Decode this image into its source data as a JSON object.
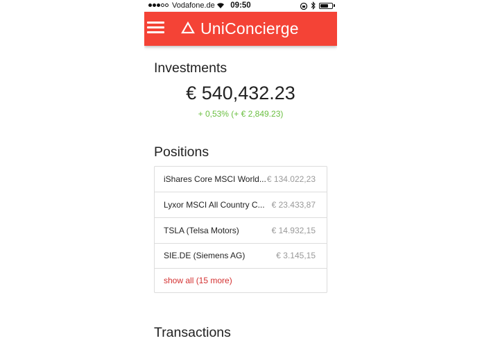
{
  "status_bar": {
    "carrier": "Vodafone.de",
    "time": "09:50",
    "battery_level": 0.7
  },
  "app_bar": {
    "brand": "UniConcierge"
  },
  "investments": {
    "title": "Investments",
    "total": "€ 540,432.23",
    "change": "+ 0,53% (+ € 2,849.23)"
  },
  "positions": {
    "title": "Positions",
    "items": [
      {
        "name": "iShares Core MSCI World...",
        "value": "€ 134.022,23"
      },
      {
        "name": "Lyxor MSCI All Country C...",
        "value": "€ 23.433,87"
      },
      {
        "name": "TSLA (Telsa Motors)",
        "value": "€ 14.932,15"
      },
      {
        "name": "SIE.DE (Siemens AG)",
        "value": "€ 3.145,15"
      }
    ],
    "show_all": "show all (15 more)"
  },
  "transactions": {
    "title": "Transactions"
  },
  "colors": {
    "accent": "#f44336",
    "positive": "#6abf40",
    "link": "#d32f2f"
  }
}
